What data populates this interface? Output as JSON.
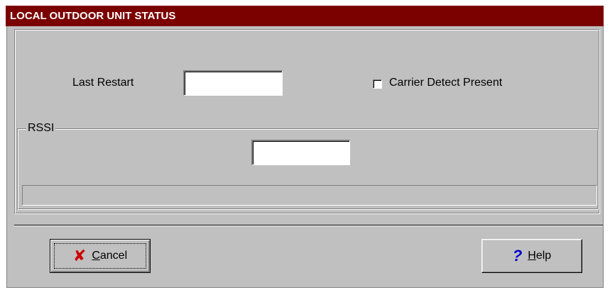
{
  "window": {
    "title": "LOCAL OUTDOOR UNIT STATUS",
    "title_bg": "#7b0000"
  },
  "fields": {
    "last_restart": {
      "label": "Last Restart",
      "value": ""
    },
    "carrier_detect": {
      "label": "Carrier Detect Present",
      "checked": false
    }
  },
  "rssi": {
    "legend": "RSSI",
    "value": "",
    "progress": 0
  },
  "buttons": {
    "cancel": {
      "accel": "C",
      "rest": "ancel",
      "icon": "red-x-icon",
      "icon_color": "#cc0000",
      "icon_glyph": "✘"
    },
    "help": {
      "accel": "H",
      "rest": "elp",
      "icon": "question-mark-icon",
      "icon_color": "#0000cc",
      "icon_glyph": "?"
    }
  }
}
